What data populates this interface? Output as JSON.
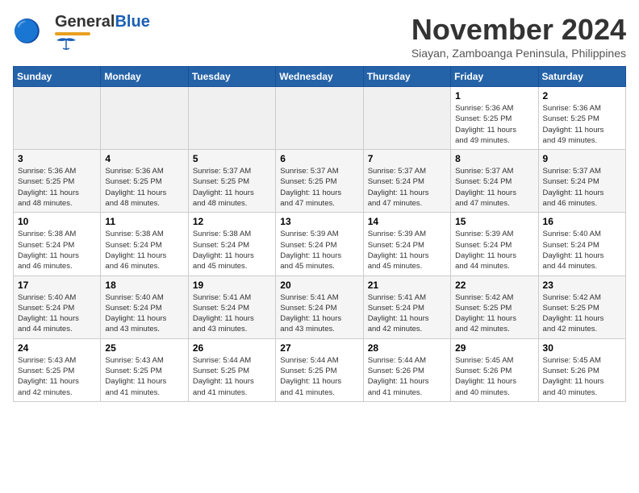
{
  "header": {
    "logo_general": "General",
    "logo_blue": "Blue",
    "month": "November 2024",
    "location": "Siayan, Zamboanga Peninsula, Philippines"
  },
  "days_of_week": [
    "Sunday",
    "Monday",
    "Tuesday",
    "Wednesday",
    "Thursday",
    "Friday",
    "Saturday"
  ],
  "weeks": [
    {
      "days": [
        {
          "num": "",
          "info": "",
          "empty": true
        },
        {
          "num": "",
          "info": "",
          "empty": true
        },
        {
          "num": "",
          "info": "",
          "empty": true
        },
        {
          "num": "",
          "info": "",
          "empty": true
        },
        {
          "num": "",
          "info": "",
          "empty": true
        },
        {
          "num": "1",
          "info": "Sunrise: 5:36 AM\nSunset: 5:25 PM\nDaylight: 11 hours\nand 49 minutes."
        },
        {
          "num": "2",
          "info": "Sunrise: 5:36 AM\nSunset: 5:25 PM\nDaylight: 11 hours\nand 49 minutes."
        }
      ]
    },
    {
      "days": [
        {
          "num": "3",
          "info": "Sunrise: 5:36 AM\nSunset: 5:25 PM\nDaylight: 11 hours\nand 48 minutes."
        },
        {
          "num": "4",
          "info": "Sunrise: 5:36 AM\nSunset: 5:25 PM\nDaylight: 11 hours\nand 48 minutes."
        },
        {
          "num": "5",
          "info": "Sunrise: 5:37 AM\nSunset: 5:25 PM\nDaylight: 11 hours\nand 48 minutes."
        },
        {
          "num": "6",
          "info": "Sunrise: 5:37 AM\nSunset: 5:25 PM\nDaylight: 11 hours\nand 47 minutes."
        },
        {
          "num": "7",
          "info": "Sunrise: 5:37 AM\nSunset: 5:24 PM\nDaylight: 11 hours\nand 47 minutes."
        },
        {
          "num": "8",
          "info": "Sunrise: 5:37 AM\nSunset: 5:24 PM\nDaylight: 11 hours\nand 47 minutes."
        },
        {
          "num": "9",
          "info": "Sunrise: 5:37 AM\nSunset: 5:24 PM\nDaylight: 11 hours\nand 46 minutes."
        }
      ]
    },
    {
      "days": [
        {
          "num": "10",
          "info": "Sunrise: 5:38 AM\nSunset: 5:24 PM\nDaylight: 11 hours\nand 46 minutes."
        },
        {
          "num": "11",
          "info": "Sunrise: 5:38 AM\nSunset: 5:24 PM\nDaylight: 11 hours\nand 46 minutes."
        },
        {
          "num": "12",
          "info": "Sunrise: 5:38 AM\nSunset: 5:24 PM\nDaylight: 11 hours\nand 45 minutes."
        },
        {
          "num": "13",
          "info": "Sunrise: 5:39 AM\nSunset: 5:24 PM\nDaylight: 11 hours\nand 45 minutes."
        },
        {
          "num": "14",
          "info": "Sunrise: 5:39 AM\nSunset: 5:24 PM\nDaylight: 11 hours\nand 45 minutes."
        },
        {
          "num": "15",
          "info": "Sunrise: 5:39 AM\nSunset: 5:24 PM\nDaylight: 11 hours\nand 44 minutes."
        },
        {
          "num": "16",
          "info": "Sunrise: 5:40 AM\nSunset: 5:24 PM\nDaylight: 11 hours\nand 44 minutes."
        }
      ]
    },
    {
      "days": [
        {
          "num": "17",
          "info": "Sunrise: 5:40 AM\nSunset: 5:24 PM\nDaylight: 11 hours\nand 44 minutes."
        },
        {
          "num": "18",
          "info": "Sunrise: 5:40 AM\nSunset: 5:24 PM\nDaylight: 11 hours\nand 43 minutes."
        },
        {
          "num": "19",
          "info": "Sunrise: 5:41 AM\nSunset: 5:24 PM\nDaylight: 11 hours\nand 43 minutes."
        },
        {
          "num": "20",
          "info": "Sunrise: 5:41 AM\nSunset: 5:24 PM\nDaylight: 11 hours\nand 43 minutes."
        },
        {
          "num": "21",
          "info": "Sunrise: 5:41 AM\nSunset: 5:24 PM\nDaylight: 11 hours\nand 42 minutes."
        },
        {
          "num": "22",
          "info": "Sunrise: 5:42 AM\nSunset: 5:25 PM\nDaylight: 11 hours\nand 42 minutes."
        },
        {
          "num": "23",
          "info": "Sunrise: 5:42 AM\nSunset: 5:25 PM\nDaylight: 11 hours\nand 42 minutes."
        }
      ]
    },
    {
      "days": [
        {
          "num": "24",
          "info": "Sunrise: 5:43 AM\nSunset: 5:25 PM\nDaylight: 11 hours\nand 42 minutes."
        },
        {
          "num": "25",
          "info": "Sunrise: 5:43 AM\nSunset: 5:25 PM\nDaylight: 11 hours\nand 41 minutes."
        },
        {
          "num": "26",
          "info": "Sunrise: 5:44 AM\nSunset: 5:25 PM\nDaylight: 11 hours\nand 41 minutes."
        },
        {
          "num": "27",
          "info": "Sunrise: 5:44 AM\nSunset: 5:25 PM\nDaylight: 11 hours\nand 41 minutes."
        },
        {
          "num": "28",
          "info": "Sunrise: 5:44 AM\nSunset: 5:26 PM\nDaylight: 11 hours\nand 41 minutes."
        },
        {
          "num": "29",
          "info": "Sunrise: 5:45 AM\nSunset: 5:26 PM\nDaylight: 11 hours\nand 40 minutes."
        },
        {
          "num": "30",
          "info": "Sunrise: 5:45 AM\nSunset: 5:26 PM\nDaylight: 11 hours\nand 40 minutes."
        }
      ]
    }
  ]
}
